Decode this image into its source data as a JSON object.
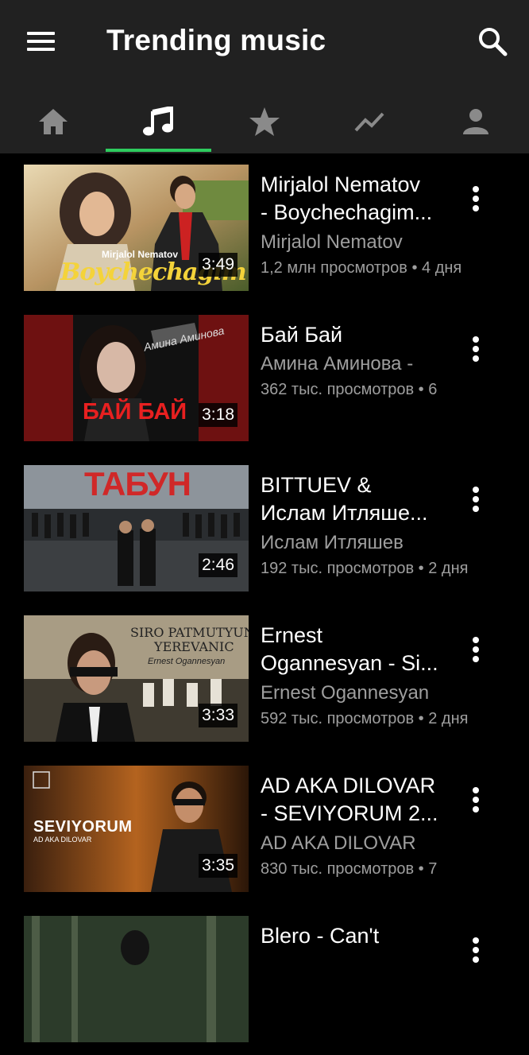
{
  "app": {
    "title": "Trending music",
    "tabs": [
      {
        "icon": "home-icon"
      },
      {
        "icon": "music-note-icon",
        "selected": true
      },
      {
        "icon": "star-icon"
      },
      {
        "icon": "trending-icon"
      },
      {
        "icon": "person-icon"
      }
    ],
    "accent_color": "#2ecc5f"
  },
  "videos": [
    {
      "title_line1": "Mirjalol Nematov",
      "title_line2": "- Boychechagim...",
      "channel": "Mirjalol Nematov",
      "meta": "1,2 млн просмотров • 4 дня",
      "duration": "3:49",
      "thumb_text": "Boychechagim",
      "thumb_small": "Mirjalol Nematov"
    },
    {
      "title_line1": "Бай Бай",
      "title_line2": "",
      "channel": "Амина Аминова -",
      "meta": "362 тыс. просмотров • 6",
      "duration": "3:18",
      "thumb_text": "БАЙ БАЙ",
      "thumb_small": "Амина Аминова"
    },
    {
      "title_line1": "BITTUEV &",
      "title_line2": "Ислам Итляше...",
      "channel": "Ислам Итляшев",
      "meta": "192 тыс. просмотров • 2 дня",
      "duration": "2:46",
      "thumb_text": "ТАБУН",
      "thumb_small": ""
    },
    {
      "title_line1": "Ernest",
      "title_line2": "Ogannesyan - Si...",
      "channel": "Ernest Ogannesyan",
      "meta": "592 тыс. просмотров • 2 дня",
      "duration": "3:33",
      "thumb_text": "SIRO PATMUTYUN",
      "thumb_text2": "YEREVANIC",
      "thumb_small": "Ernest Ogannesyan"
    },
    {
      "title_line1": "AD AKA DILOVAR",
      "title_line2": "- SEVIYORUM 2...",
      "channel": "AD AKA DILOVAR",
      "meta": "830 тыс. просмотров • 7",
      "duration": "3:35",
      "thumb_text": "SEVIYORUM",
      "thumb_small": "AD AKA DILOVAR"
    },
    {
      "title_line1": "Blero - Can't",
      "title_line2": "",
      "channel": "",
      "meta": "",
      "duration": "",
      "thumb_text": "",
      "thumb_small": ""
    }
  ]
}
